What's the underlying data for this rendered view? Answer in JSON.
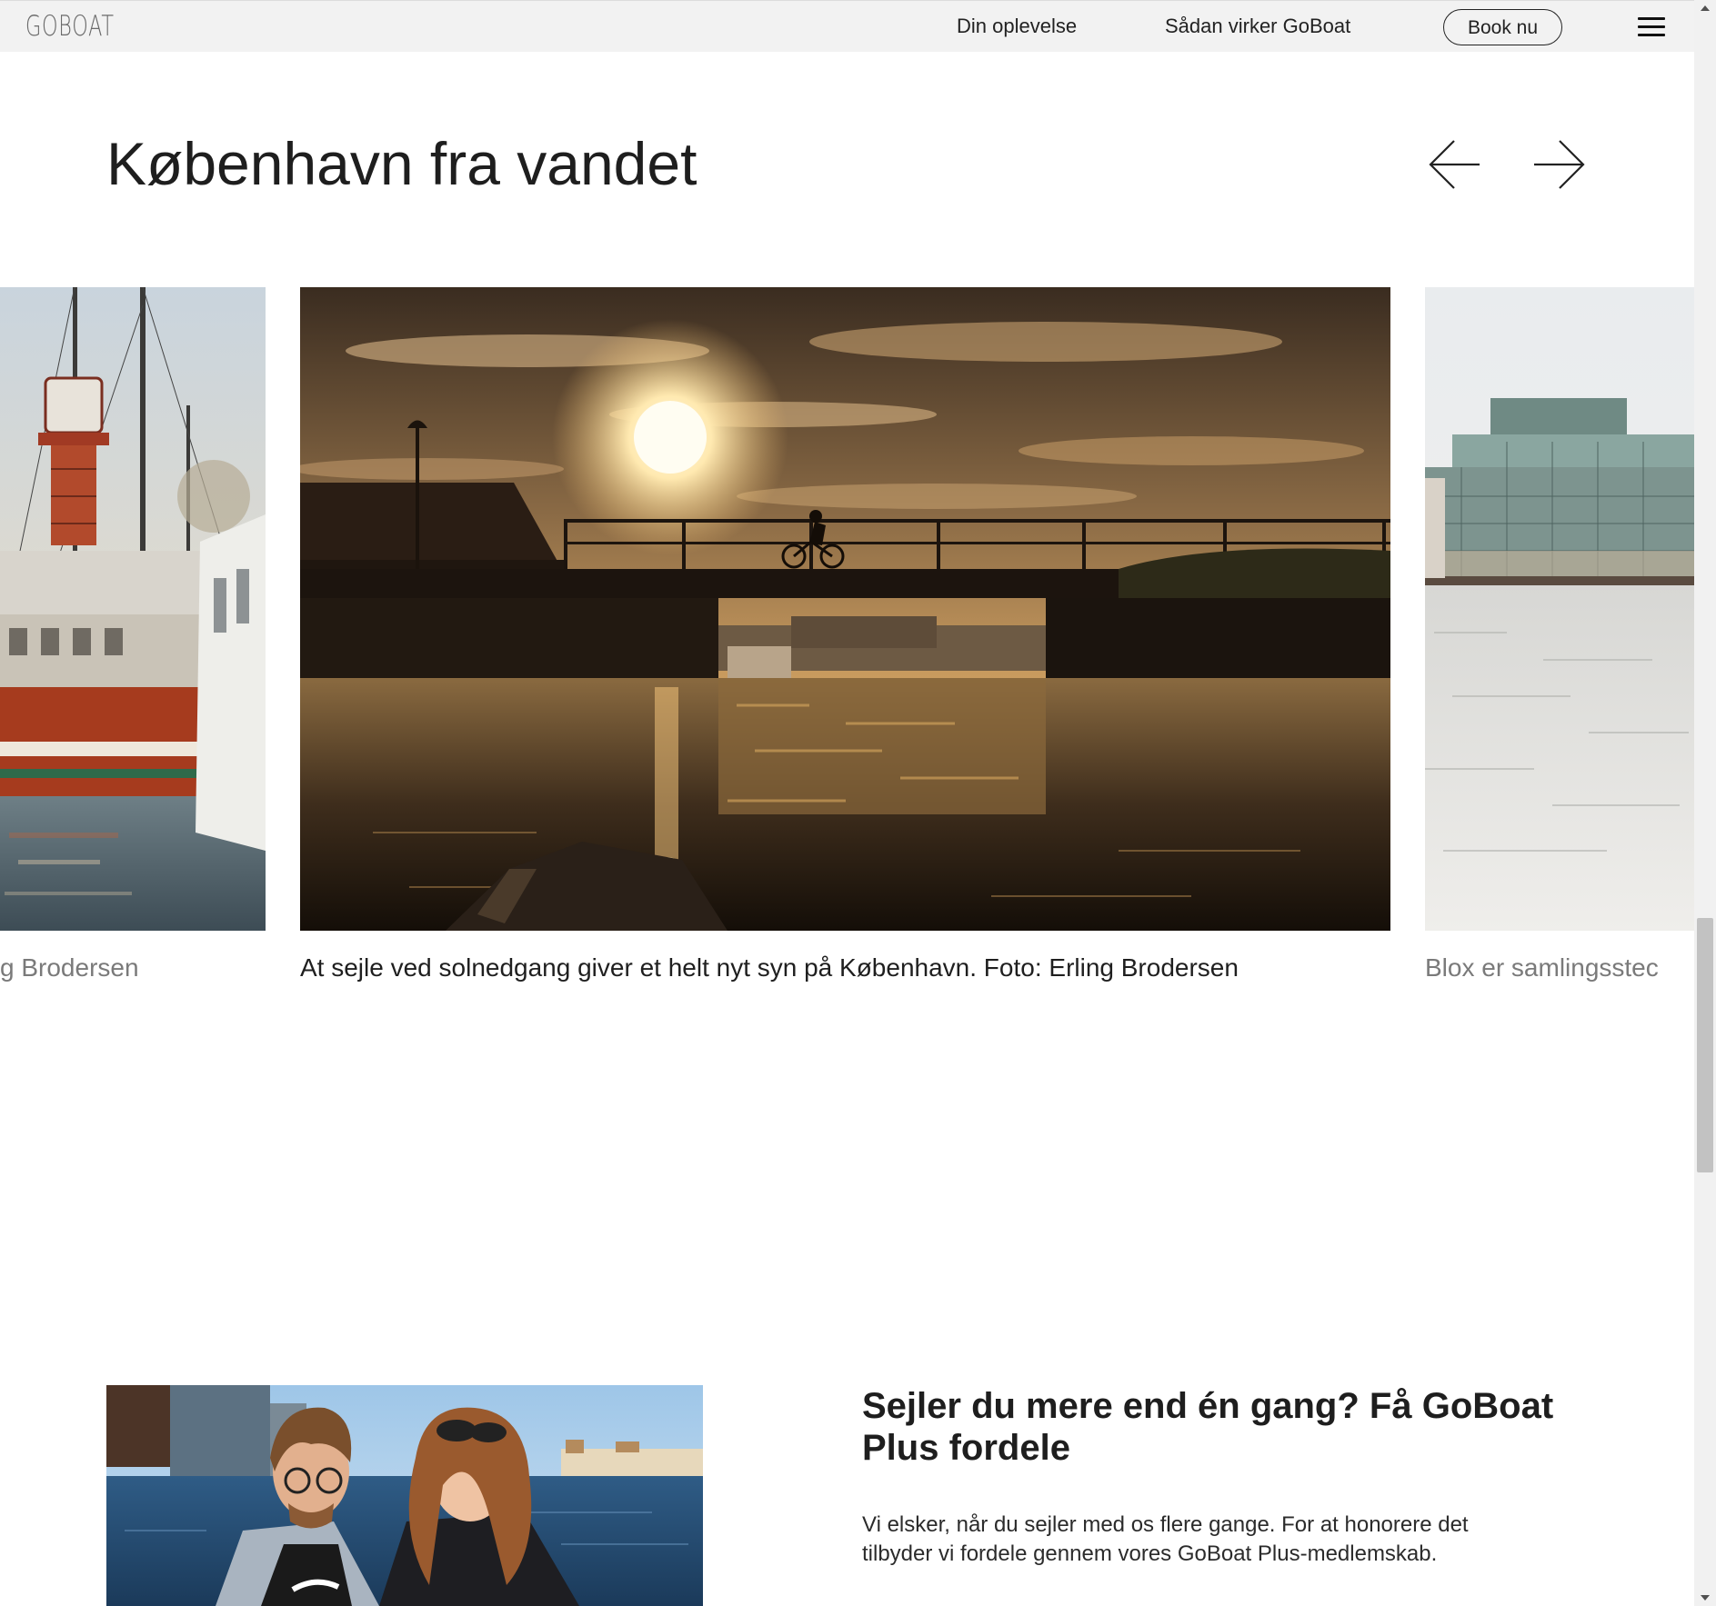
{
  "header": {
    "logo_text": "GOBOAT",
    "nav": [
      {
        "label": "Din oplevelse"
      },
      {
        "label": "Sådan virker GoBoat"
      }
    ],
    "cta_label": "Book nu",
    "menu_icon": "hamburger-menu-icon"
  },
  "gallery": {
    "title": "København fra vandet",
    "prev_icon": "arrow-left-icon",
    "next_icon": "arrow-right-icon",
    "slides": [
      {
        "caption": "g Brodersen",
        "image": "lightship-harbor-photo"
      },
      {
        "caption": "At sejle ved solnedgang giver et helt nyt syn på København. Foto: Erling Brodersen",
        "image": "sunset-bridge-cyclist-photo"
      },
      {
        "caption": "Blox er samlingsstec",
        "image": "blox-building-waterfront-photo"
      }
    ]
  },
  "promo": {
    "heading": "Sejler du mere end én gang? Få GoBoat Plus fordele",
    "body": "Vi elsker, når du sejler med os flere gange. For at honorere det tilbyder vi fordele gennem vores GoBoat Plus-medlemskab.",
    "image": "couple-on-boat-photo"
  },
  "colors": {
    "topbar_bg": "#f2f2f2",
    "text": "#1f1f1f",
    "muted_caption": "#7a7a7a"
  }
}
